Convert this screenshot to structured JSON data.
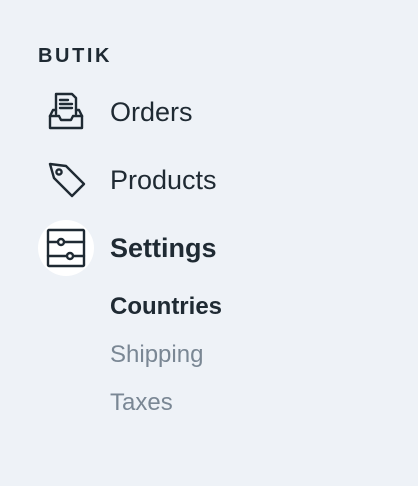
{
  "brand": "BUTIK",
  "nav": {
    "orders": {
      "label": "Orders",
      "icon": "inbox-document-icon"
    },
    "products": {
      "label": "Products",
      "icon": "tag-icon"
    },
    "settings": {
      "label": "Settings",
      "icon": "sliders-icon",
      "active": true
    }
  },
  "settings_sub": [
    {
      "label": "Countries",
      "active": true
    },
    {
      "label": "Shipping",
      "active": false
    },
    {
      "label": "Taxes",
      "active": false
    }
  ],
  "colors": {
    "background": "#eef2f7",
    "text": "#1f2a33",
    "muted": "#7a8794",
    "active_icon_bg": "#ffffff"
  }
}
